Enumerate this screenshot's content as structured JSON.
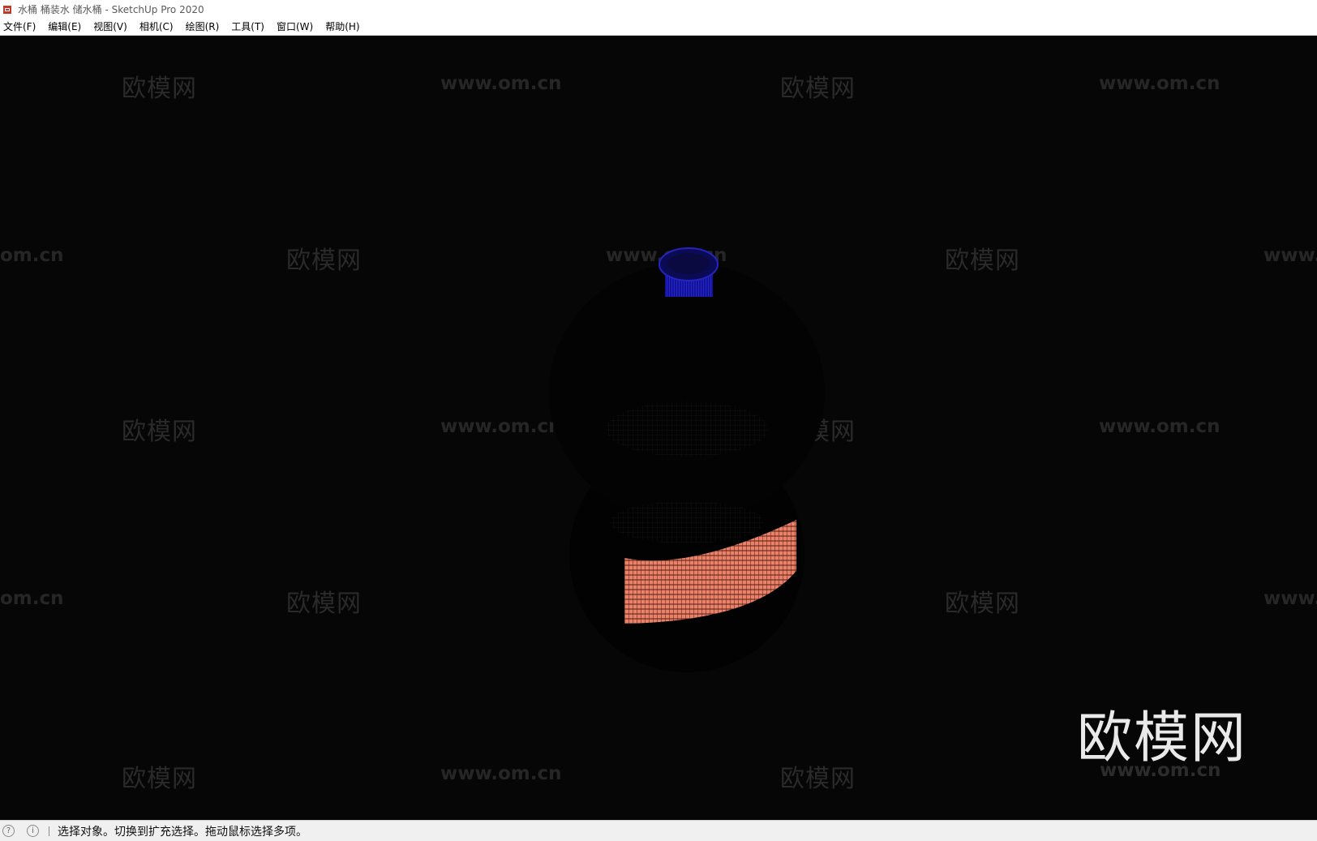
{
  "window": {
    "title": "水桶 桶装水 储水桶 - SketchUp Pro 2020"
  },
  "menubar": {
    "items": [
      {
        "label": "文件(F)"
      },
      {
        "label": "编辑(E)"
      },
      {
        "label": "视图(V)"
      },
      {
        "label": "相机(C)"
      },
      {
        "label": "绘图(R)"
      },
      {
        "label": "工具(T)"
      },
      {
        "label": "窗口(W)"
      },
      {
        "label": "帮助(H)"
      }
    ]
  },
  "viewport": {
    "background_color": "#060606",
    "model": {
      "cap_color": "#1a1aa8",
      "label_color": "#e8826a"
    },
    "watermark": {
      "logo_text": "欧模网",
      "url_text": "www.om.cn",
      "url_partial_left": "om.cn",
      "url_partial_right": "www."
    }
  },
  "statusbar": {
    "icons": [
      "geo-location-icon",
      "info-icon"
    ],
    "message": "选择对象。切换到扩充选择。拖动鼠标选择多项。"
  }
}
